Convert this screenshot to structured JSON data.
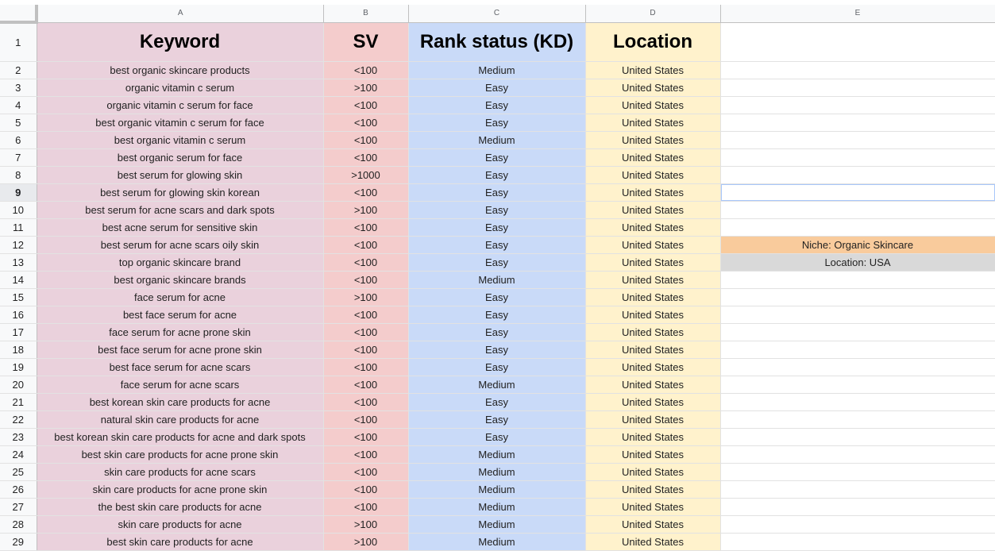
{
  "columns": [
    "A",
    "B",
    "C",
    "D",
    "E"
  ],
  "header": {
    "row_number": "1",
    "keyword": "Keyword",
    "sv": "SV",
    "rank_status": "Rank status (KD)",
    "location": "Location"
  },
  "selected_row": "9",
  "rows": [
    {
      "n": "2",
      "keyword": "best organic skincare products",
      "sv": "<100",
      "kd": "Medium",
      "location": "United States",
      "e": ""
    },
    {
      "n": "3",
      "keyword": "organic vitamin c serum",
      "sv": ">100",
      "kd": "Easy",
      "location": "United States",
      "e": ""
    },
    {
      "n": "4",
      "keyword": "organic vitamin c serum for face",
      "sv": "<100",
      "kd": "Easy",
      "location": "United States",
      "e": ""
    },
    {
      "n": "5",
      "keyword": "best organic vitamin c serum for face",
      "sv": "<100",
      "kd": "Easy",
      "location": "United States",
      "e": ""
    },
    {
      "n": "6",
      "keyword": "best organic vitamin c serum",
      "sv": "<100",
      "kd": "Medium",
      "location": "United States",
      "e": ""
    },
    {
      "n": "7",
      "keyword": "best organic serum for face",
      "sv": "<100",
      "kd": "Easy",
      "location": "United States",
      "e": ""
    },
    {
      "n": "8",
      "keyword": "best serum for glowing skin",
      "sv": ">1000",
      "kd": "Easy",
      "location": "United States",
      "e": ""
    },
    {
      "n": "9",
      "keyword": "best serum for glowing skin korean",
      "sv": "<100",
      "kd": "Easy",
      "location": "United States",
      "e": ""
    },
    {
      "n": "10",
      "keyword": "best serum for acne scars and dark spots",
      "sv": ">100",
      "kd": "Easy",
      "location": "United States",
      "e": ""
    },
    {
      "n": "11",
      "keyword": "best acne serum for sensitive skin",
      "sv": "<100",
      "kd": "Easy",
      "location": "United States",
      "e": ""
    },
    {
      "n": "12",
      "keyword": "best serum for acne scars oily skin",
      "sv": "<100",
      "kd": "Easy",
      "location": "United States",
      "e": "Niche: Organic Skincare"
    },
    {
      "n": "13",
      "keyword": "top organic skincare brand",
      "sv": "<100",
      "kd": "Easy",
      "location": "United States",
      "e": "Location: USA"
    },
    {
      "n": "14",
      "keyword": "best organic skincare brands",
      "sv": "<100",
      "kd": "Medium",
      "location": "United States",
      "e": ""
    },
    {
      "n": "15",
      "keyword": "face serum for acne",
      "sv": ">100",
      "kd": "Easy",
      "location": "United States",
      "e": ""
    },
    {
      "n": "16",
      "keyword": "best face serum for acne",
      "sv": "<100",
      "kd": "Easy",
      "location": "United States",
      "e": ""
    },
    {
      "n": "17",
      "keyword": "face serum for acne prone skin",
      "sv": "<100",
      "kd": "Easy",
      "location": "United States",
      "e": ""
    },
    {
      "n": "18",
      "keyword": "best face serum for acne prone skin",
      "sv": "<100",
      "kd": "Easy",
      "location": "United States",
      "e": ""
    },
    {
      "n": "19",
      "keyword": "best face serum for acne scars",
      "sv": "<100",
      "kd": "Easy",
      "location": "United States",
      "e": ""
    },
    {
      "n": "20",
      "keyword": "face serum for acne scars",
      "sv": "<100",
      "kd": "Medium",
      "location": "United States",
      "e": ""
    },
    {
      "n": "21",
      "keyword": "best korean skin care products for acne",
      "sv": "<100",
      "kd": "Easy",
      "location": "United States",
      "e": ""
    },
    {
      "n": "22",
      "keyword": "natural skin care products for acne",
      "sv": "<100",
      "kd": "Easy",
      "location": "United States",
      "e": ""
    },
    {
      "n": "23",
      "keyword": "best korean skin care products for acne and dark spots",
      "sv": "<100",
      "kd": "Easy",
      "location": "United States",
      "e": ""
    },
    {
      "n": "24",
      "keyword": "best skin care products for acne prone skin",
      "sv": "<100",
      "kd": "Medium",
      "location": "United States",
      "e": ""
    },
    {
      "n": "25",
      "keyword": "skin care products for acne scars",
      "sv": "<100",
      "kd": "Medium",
      "location": "United States",
      "e": ""
    },
    {
      "n": "26",
      "keyword": "skin care products for acne prone skin",
      "sv": "<100",
      "kd": "Medium",
      "location": "United States",
      "e": ""
    },
    {
      "n": "27",
      "keyword": "the best skin care products for acne",
      "sv": "<100",
      "kd": "Medium",
      "location": "United States",
      "e": ""
    },
    {
      "n": "28",
      "keyword": "skin care products for acne",
      "sv": ">100",
      "kd": "Medium",
      "location": "United States",
      "e": ""
    },
    {
      "n": "29",
      "keyword": "best skin care products for acne",
      "sv": ">100",
      "kd": "Medium",
      "location": "United States",
      "e": ""
    }
  ],
  "colors": {
    "keyword_fill": "#ead1dc",
    "sv_fill": "#f4cccc",
    "kd_fill": "#c9daf8",
    "location_fill": "#fff2cc",
    "niche_fill": "#f9cb9c",
    "location_note_fill": "#d9d9d9"
  }
}
